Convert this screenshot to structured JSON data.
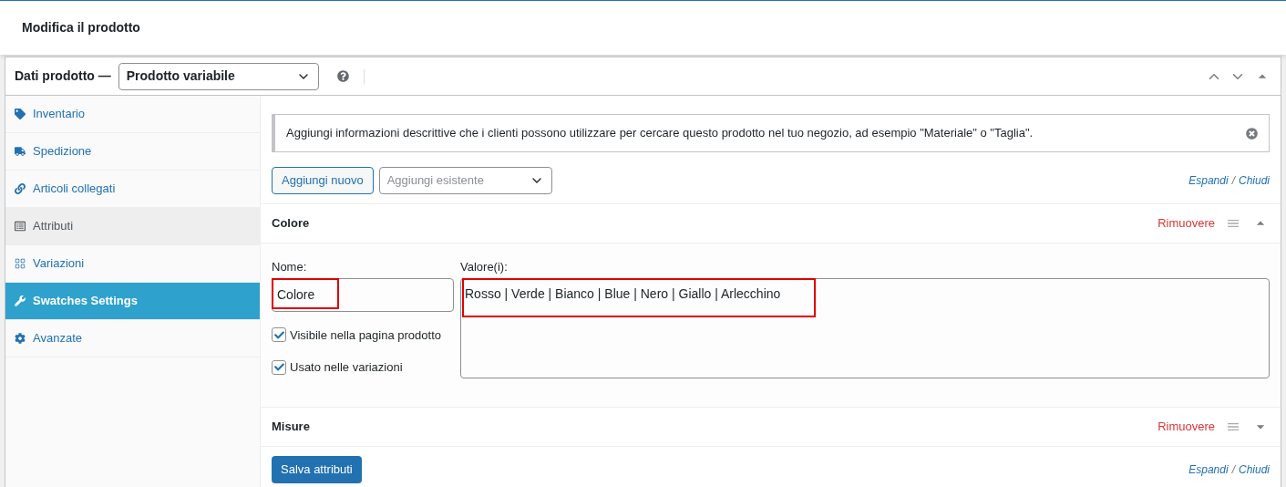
{
  "page_title": "Modifica il prodotto",
  "panel": {
    "label": "Dati prodotto —",
    "product_type": "Prodotto variabile"
  },
  "sidebar": {
    "items": [
      {
        "label": "Inventario",
        "kind": "tag",
        "selected": false,
        "highlighted": false
      },
      {
        "label": "Spedizione",
        "kind": "truck",
        "selected": false,
        "highlighted": false
      },
      {
        "label": "Articoli collegati",
        "kind": "link",
        "selected": false,
        "highlighted": false
      },
      {
        "label": "Attributi",
        "kind": "list",
        "selected": false,
        "highlighted": true
      },
      {
        "label": "Variazioni",
        "kind": "grid",
        "selected": false,
        "highlighted": false
      },
      {
        "label": "Swatches Settings",
        "kind": "wrench",
        "selected": true,
        "highlighted": false
      },
      {
        "label": "Avanzate",
        "kind": "gear",
        "selected": false,
        "highlighted": false
      }
    ]
  },
  "notice": "Aggiungi informazioni descrittive che i clienti possono utilizzare per cercare questo prodotto nel tuo negozio, ad esempio \"Materiale\" o \"Taglia\".",
  "add_new_button": "Aggiungi nuovo",
  "add_existing": {
    "placeholder": "Aggiungi esistente"
  },
  "expand_links": {
    "expand": "Espandi",
    "separator": "/",
    "collapse": "Chiudi"
  },
  "attributes": [
    {
      "title": "Colore",
      "remove": "Rimuovere",
      "expanded": true,
      "name_label": "Nome:",
      "name_value": "Colore",
      "name_highlighted": true,
      "values_label": "Valore(i):",
      "values": "Rosso | Verde | Bianco | Blue | Nero | Giallo | Arlecchino",
      "values_highlighted": true,
      "options": [
        {
          "label": "Visibile nella pagina prodotto",
          "checked": true
        },
        {
          "label": "Usato nelle variazioni",
          "checked": true
        }
      ]
    },
    {
      "title": "Misure",
      "remove": "Rimuovere",
      "expanded": false
    }
  ],
  "save_button": "Salva attributi",
  "footer_links": {
    "expand": "Espandi",
    "separator": "/",
    "collapse": "Chiudi"
  }
}
